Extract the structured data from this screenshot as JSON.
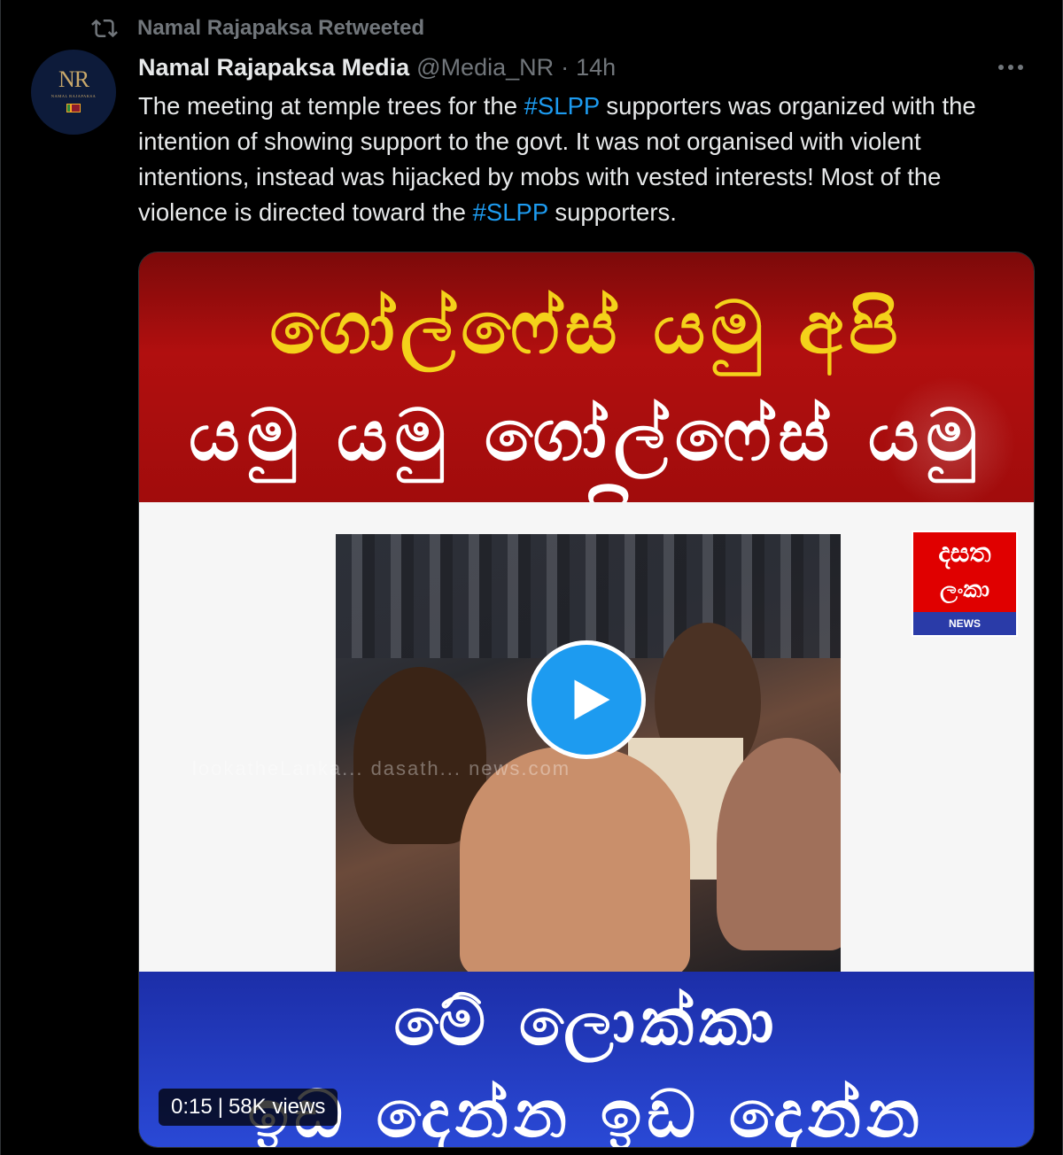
{
  "social_context": {
    "icon": "retweet-icon",
    "text": "Namal Rajapaksa Retweeted"
  },
  "author": {
    "avatar_monogram": "NR",
    "avatar_subtitle": "NAMAL RAJAPAKSA",
    "name": "Namal Rajapaksa Media",
    "handle": "@Media_NR",
    "separator": "·",
    "time": "14h"
  },
  "tweet": {
    "text_1": "The meeting at temple trees for the ",
    "hashtag_1": "#SLPP",
    "text_2": " supporters was organized with the intention of showing support to the govt. It was not organised with violent intentions, instead was hijacked by mobs with vested interests! Most of the violence is directed toward the ",
    "hashtag_2": "#SLPP",
    "text_3": " supporters."
  },
  "media": {
    "banner_top_line1": "ගෝල්ෆේස් යමු අපි",
    "banner_top_line2": "යමු යමු ගෝල්ෆේස් යමු අපි",
    "watermark": "lookatheLanka... dasath... news.com",
    "news_logo_line1": "දසත",
    "news_logo_line2": "ලංකා",
    "news_logo_badge": "NEWS",
    "banner_bottom_line1": "මේ ලොක්කා",
    "banner_bottom_line2": "ඉඩ දෙන්න ඉඩ දෙන්න",
    "duration": "0:15",
    "views_separator": "|",
    "views": "58K views"
  },
  "colors": {
    "background": "#000000",
    "text": "#e7e9ea",
    "muted": "#71767b",
    "accent": "#1d9bf0",
    "banner_red": "#b10f0f",
    "banner_yellow_text": "#f4d21a",
    "banner_blue": "#2a49d6"
  }
}
